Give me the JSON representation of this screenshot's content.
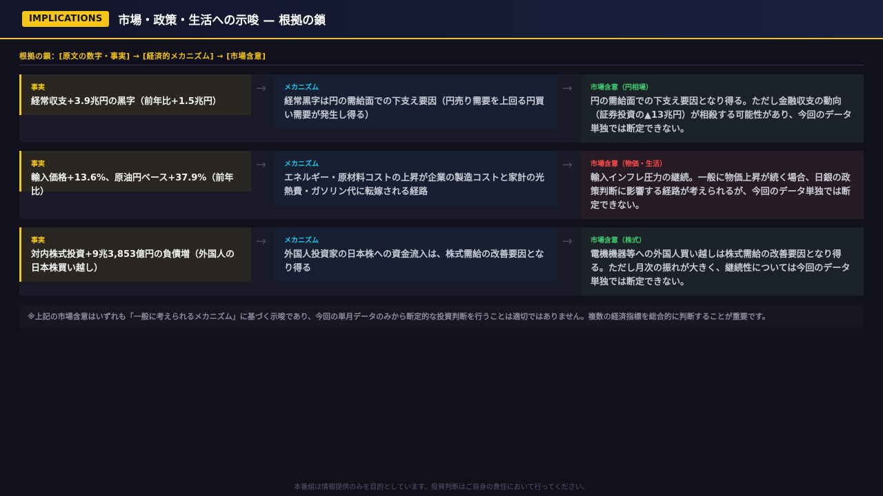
{
  "header": {
    "badge": "IMPLICATIONS",
    "title": "市場・政策・生活への示唆 — 根拠の鎖"
  },
  "chain_label": "根拠の鎖：[原文の数字・事実] → [経済的メカニズム] → [市場含意]",
  "rows": [
    {
      "fact_tag": "事実",
      "fact_text": "経常収支+3.9兆円の黒字（前年比+1.5兆円）",
      "mech_tag": "メカニズム",
      "mech_text": "経常黒字は円の需給面での下支え要因（円売り需要を上回る円買い需要が発生し得る）",
      "impl_tag": "市場含意（円相場）",
      "impl_text": "円の需給面での下支え要因となり得る。ただし金融収支の動向（証券投資の▲13兆円）が相殺する可能性があり、今回のデータ単独では断定できない。"
    },
    {
      "fact_tag": "事実",
      "fact_text": "輸入価格+13.6%、原油円ベース+37.9%（前年比）",
      "mech_tag": "メカニズム",
      "mech_text": "エネルギー・原材料コストの上昇が企業の製造コストと家計の光熱費・ガソリン代に転嫁される経路",
      "impl_tag": "市場含意（物価・生活）",
      "impl_text": "輸入インフレ圧力の継続。一般に物価上昇が続く場合、日銀の政策判断に影響する経路が考えられるが、今回のデータ単独では断定できない。"
    },
    {
      "fact_tag": "事実",
      "fact_text": "対内株式投資+9兆3,853億円の負債増（外国人の日本株買い越し）",
      "mech_tag": "メカニズム",
      "mech_text": "外国人投資家の日本株への資金流入は、株式需給の改善要因となり得る",
      "impl_tag": "市場含意（株式）",
      "impl_text": "電機機器等への外国人買い越しは株式需給の改善要因となり得る。ただし月次の振れが大きく、継続性については今回のデータ単独では断定できない。"
    }
  ],
  "arrow_glyph": "→",
  "note": "※上記の市場含意はいずれも「一般に考えられるメカニズム」に基づく示唆であり、今回の単月データのみから断定的な投資判断を行うことは適切ではありません。複数の経済指標を総合的に判断することが重要です。",
  "footer": "本番組は情報提供のみを目的としています。投資判断はご自身の責任において行ってください。",
  "colors": {
    "accent": "#f5c518",
    "mechanism": "#1ec8f0",
    "market_green": "#3dcc6e",
    "market_red": "#ff4b4b"
  }
}
